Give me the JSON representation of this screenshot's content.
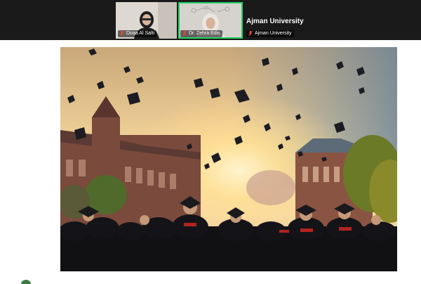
{
  "participants": [
    {
      "name": "Doaa Al Salti",
      "muted": true
    },
    {
      "name": "Dr. Zehra Edis",
      "muted": true,
      "active_speaker": true
    },
    {
      "name": "Ajman University",
      "muted": true,
      "display_title": "Ajman University"
    }
  ],
  "colors": {
    "strip_bg": "#1a1a1a",
    "active_speaker_border": "#23d160",
    "muted_icon": "#e0453a"
  },
  "shared_content": {
    "type": "photo",
    "icon": "graduation-photo"
  }
}
